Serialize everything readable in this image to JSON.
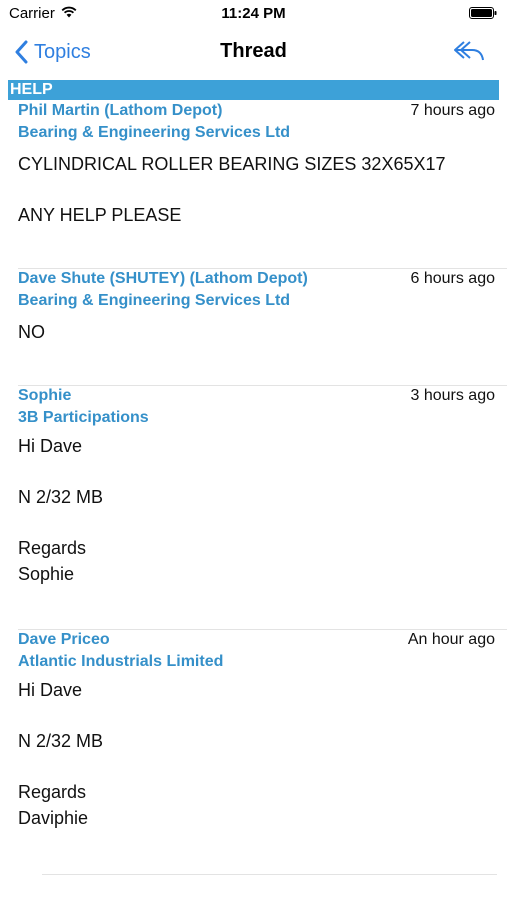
{
  "status_bar": {
    "carrier": "Carrier",
    "time": "11:24 PM"
  },
  "nav": {
    "back_label": "Topics",
    "title": "Thread"
  },
  "topic": {
    "title": "HELP"
  },
  "posts": [
    {
      "author": "Phil Martin (Lathom Depot)",
      "company": "Bearing & Engineering Services Ltd",
      "time_ago": "7 hours ago",
      "body": "CYLINDRICAL ROLLER BEARING SIZES 32X65X17\n\nANY HELP PLEASE"
    },
    {
      "author": "Dave Shute (SHUTEY) (Lathom Depot)",
      "company": "Bearing & Engineering Services Ltd",
      "time_ago": "6 hours ago",
      "body": "NO"
    },
    {
      "author": "Sophie",
      "company": "3B Participations",
      "time_ago": "3 hours ago",
      "body": "Hi Dave\n\nN 2/32 MB\n\nRegards\nSophie"
    },
    {
      "author": "Dave Priceo",
      "company": "Atlantic Industrials Limited",
      "time_ago": "An hour ago",
      "body": "Hi Dave\n\nN 2/32 MB\n\nRegards\nDaviphie"
    }
  ],
  "colors": {
    "accent": "#2f7fe0",
    "author": "#3590c9",
    "header_bg": "#3da1d8"
  }
}
